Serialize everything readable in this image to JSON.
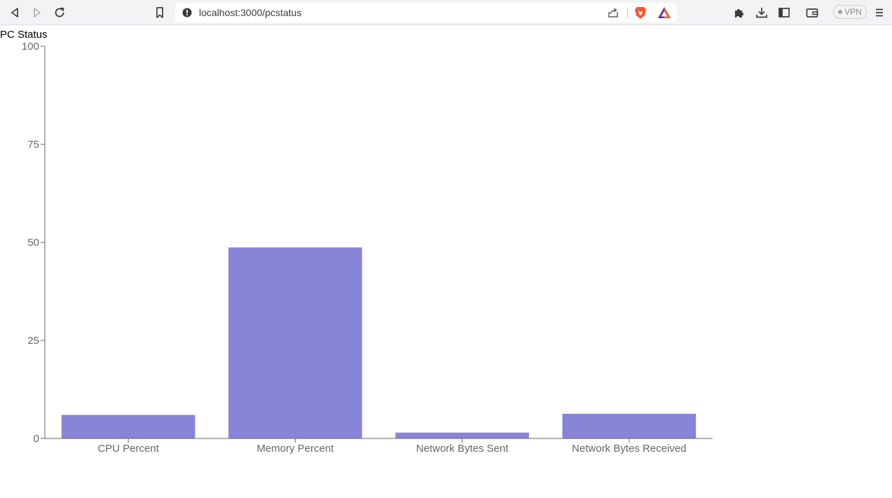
{
  "browser": {
    "url": "localhost:3000/pcstatus",
    "vpn_label": "VPN",
    "icons": [
      "back-icon",
      "forward-icon",
      "reload-icon",
      "bookmark-icon",
      "info-icon",
      "share-icon",
      "brave-shields-icon",
      "brave-rewards-icon",
      "extensions-icon",
      "downloads-icon",
      "sidebar-icon",
      "wallet-icon",
      "menu-icon"
    ]
  },
  "page": {
    "title": "PC Status"
  },
  "chart_data": {
    "type": "bar",
    "title": "",
    "xlabel": "",
    "ylabel": "",
    "categories": [
      "CPU Percent",
      "Memory Percent",
      "Network Bytes Sent",
      "Network Bytes Received"
    ],
    "values": [
      6,
      48.7,
      1.5,
      6.3
    ],
    "ylim": [
      0,
      100
    ],
    "yticks": [
      0,
      25,
      50,
      75,
      100
    ],
    "bar_color": "#8884d8",
    "grid": false
  }
}
